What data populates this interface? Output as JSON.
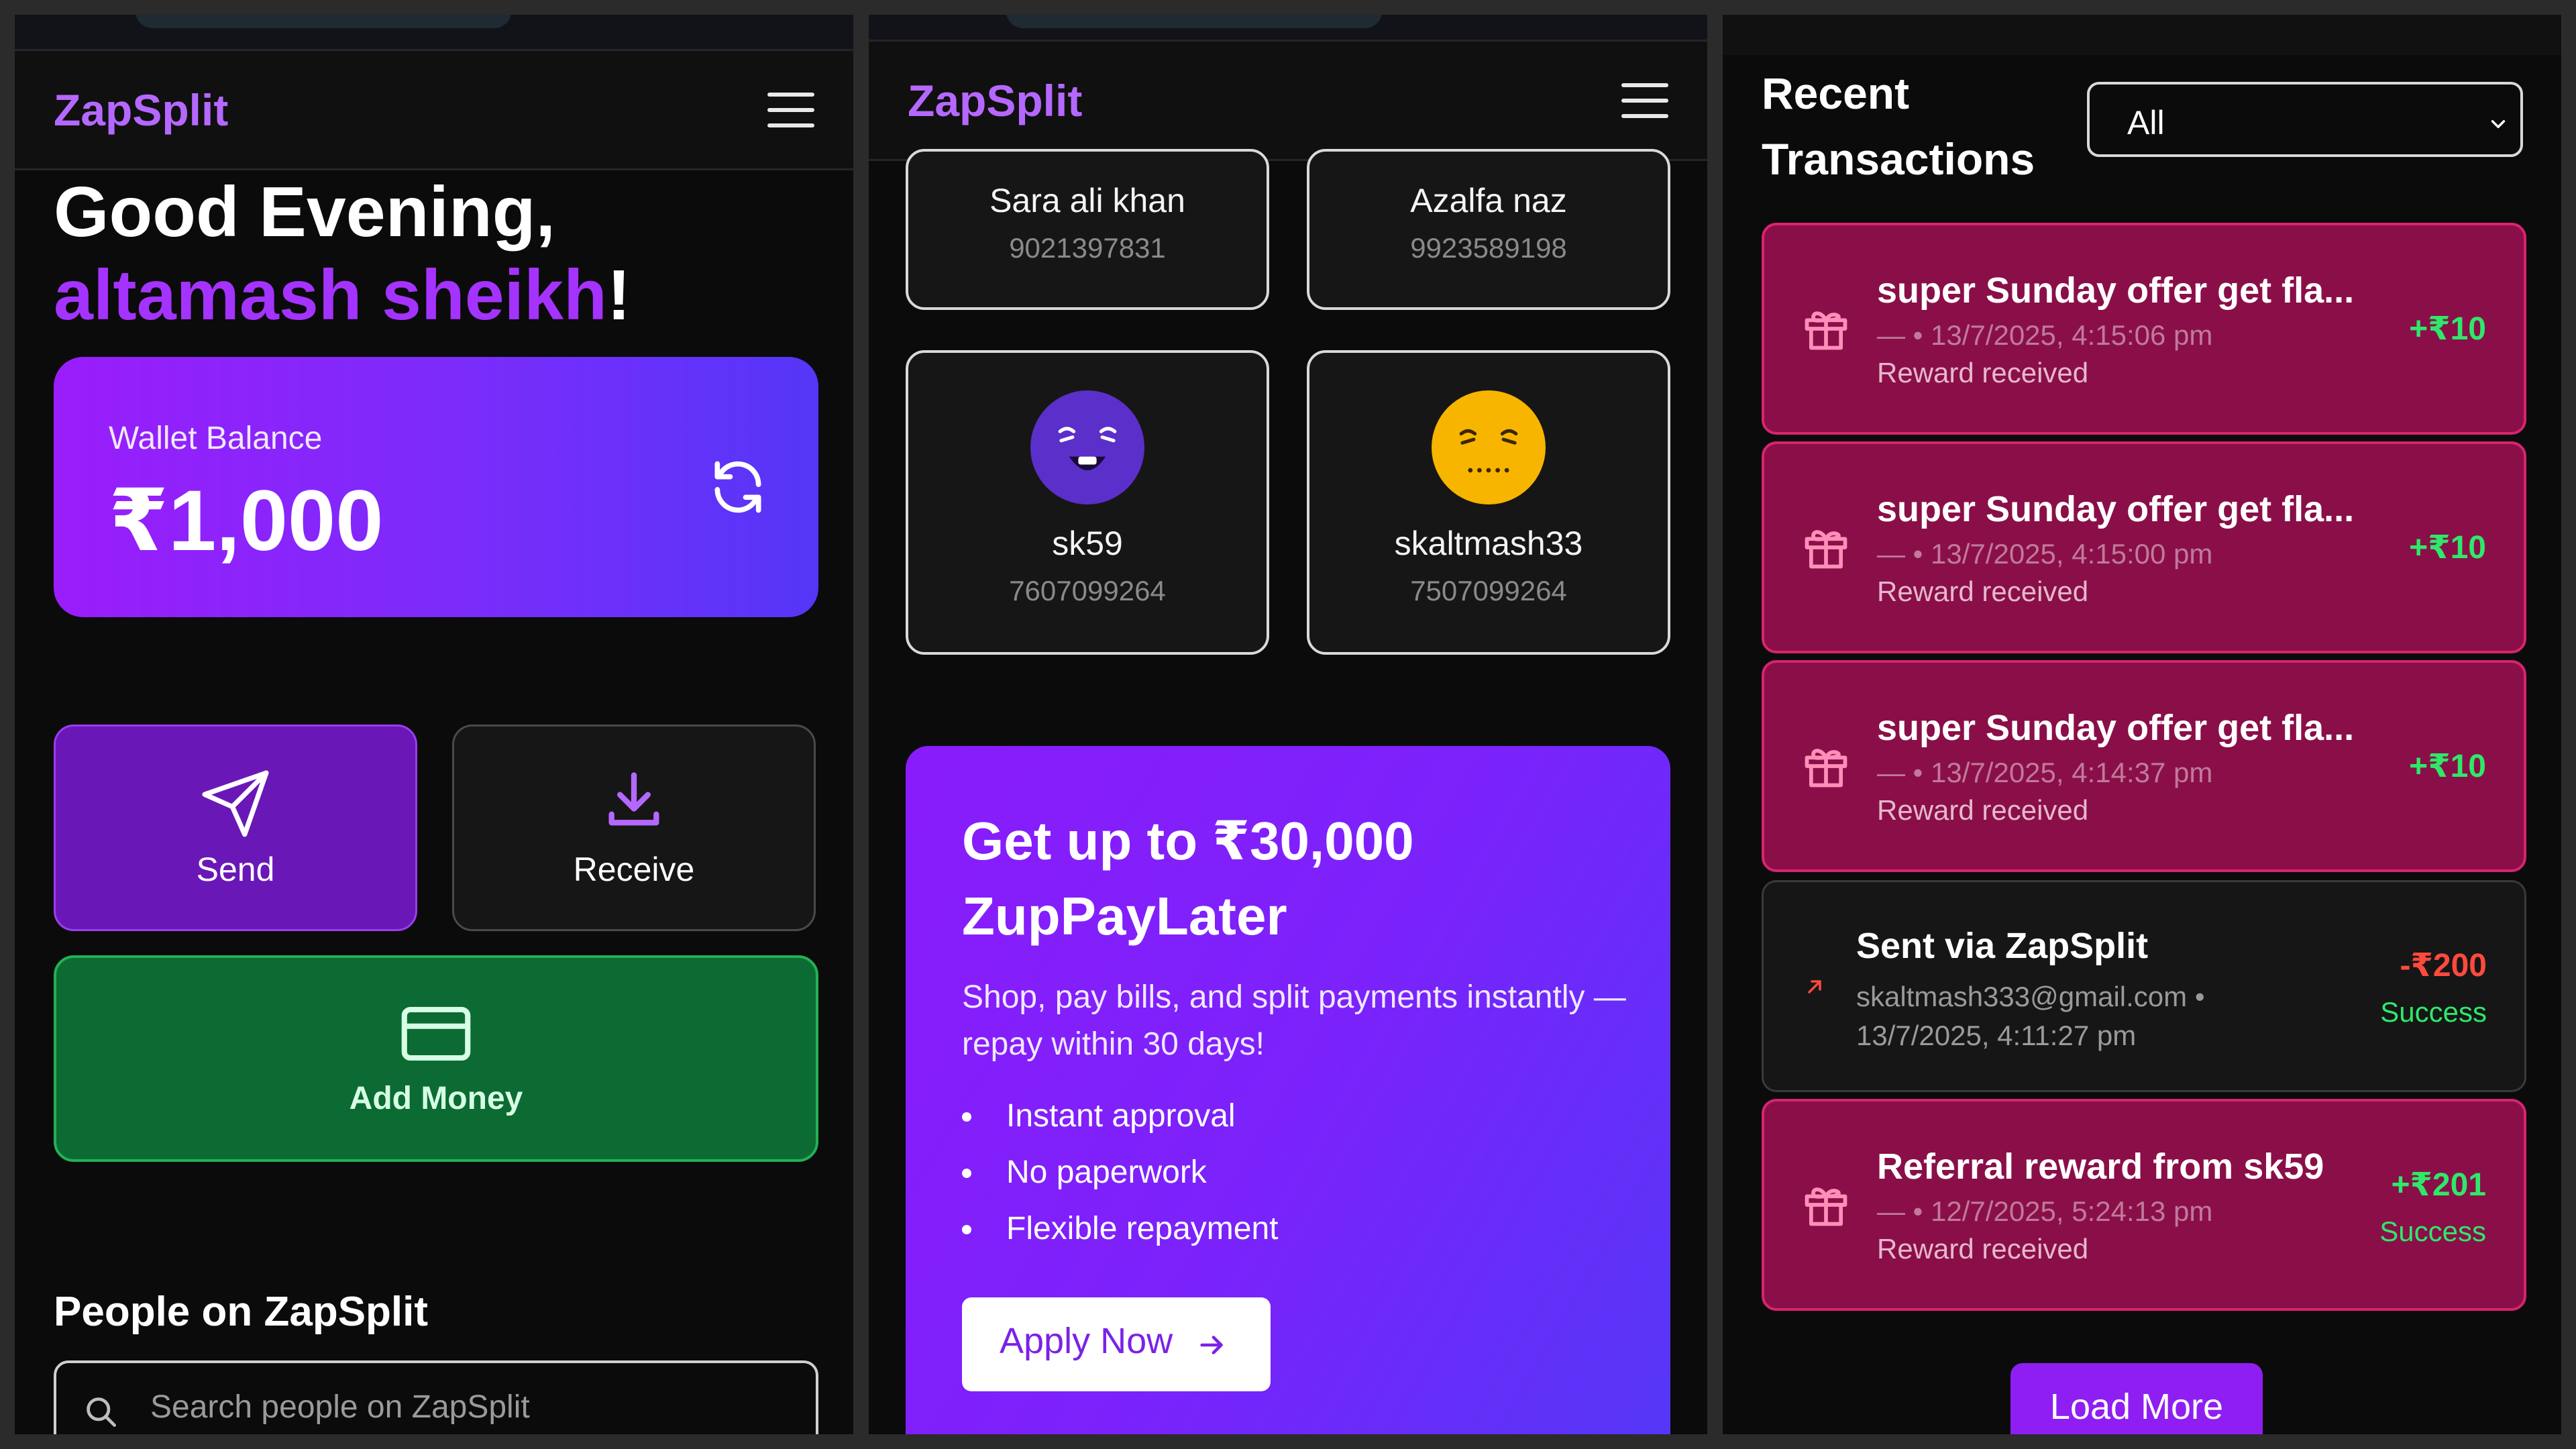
{
  "app": {
    "name": "ZapSplit",
    "accent": "#b568ff",
    "brand_purple": "#a433ff",
    "reward_card": "#8a0f48",
    "success_green": "#2ee86a",
    "debit_red": "#ff4a3d"
  },
  "home": {
    "greeting_prefix": "Good Evening, ",
    "user_name": "altamash sheikh",
    "greeting_suffix": "!",
    "wallet": {
      "label": "Wallet Balance",
      "amount": "₹1,000",
      "refresh_icon": "refresh-icon"
    },
    "actions": {
      "send_label": "Send",
      "receive_label": "Receive",
      "add_money_label": "Add Money"
    },
    "people_title": "People on ZapSplit",
    "search_placeholder": "Search people on ZapSplit"
  },
  "people": [
    {
      "name": "Sara ali khan",
      "phone": "9021397831"
    },
    {
      "name": "Azalfa naz",
      "phone": "9923589198"
    },
    {
      "name": "sk59",
      "phone": "7607099264",
      "avatar_icon": "laughing-face-icon",
      "avatar_color": "#5b2fc9"
    },
    {
      "name": "skaltmash33",
      "phone": "7507099264",
      "avatar_icon": "grimacing-face-icon",
      "avatar_color": "#f7b500"
    }
  ],
  "promo": {
    "title_line1": "Get up to ₹30,000",
    "title_line2": "ZupPayLater",
    "description": "Shop, pay bills, and split payments instantly — repay within 30 days!",
    "features": [
      "Instant approval",
      "No paperwork",
      "Flexible repayment"
    ],
    "cta_label": "Apply Now"
  },
  "transactions": {
    "title_line1": "Recent",
    "title_line2": "Transactions",
    "filter_value": "All",
    "items": [
      {
        "type": "reward",
        "title": "super Sunday offer get fla...",
        "meta": "— • 13/7/2025, 4:15:06 pm",
        "sub": "Reward received",
        "amount": "+₹10",
        "status": ""
      },
      {
        "type": "reward",
        "title": "super Sunday offer get fla...",
        "meta": "— • 13/7/2025, 4:15:00 pm",
        "sub": "Reward received",
        "amount": "+₹10",
        "status": ""
      },
      {
        "type": "reward",
        "title": "super Sunday offer get fla...",
        "meta": "— • 13/7/2025, 4:14:37 pm",
        "sub": "Reward received",
        "amount": "+₹10",
        "status": ""
      },
      {
        "type": "sent",
        "title": "Sent via ZapSplit",
        "meta": "skaltmash333@gmail.com • 13/7/2025, 4:11:27 pm",
        "sub": "",
        "amount": "-₹200",
        "status": "Success"
      },
      {
        "type": "reward",
        "title": "Referral reward from sk59",
        "meta": "— • 12/7/2025, 5:24:13 pm",
        "sub": "Reward received",
        "amount": "+₹201",
        "status": "Success"
      }
    ],
    "load_more_label": "Load More"
  }
}
